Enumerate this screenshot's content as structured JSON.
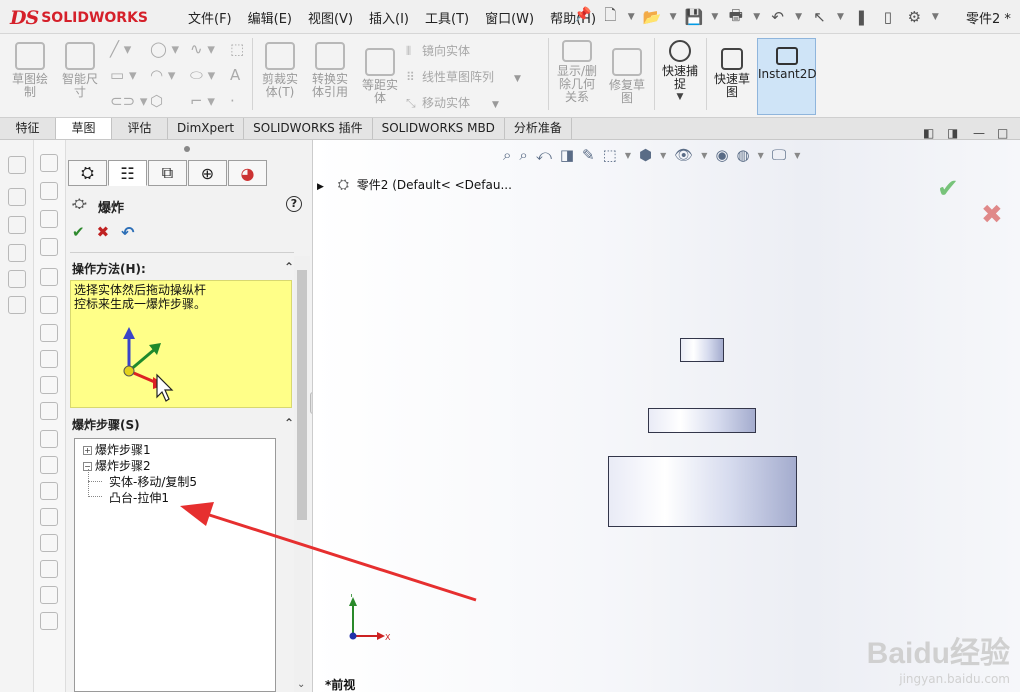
{
  "app": {
    "logo_ds": "DS",
    "logo_name": "SOLIDWORKS",
    "doc_title": "零件2 *"
  },
  "menu": [
    "文件(F)",
    "编辑(E)",
    "视图(V)",
    "插入(I)",
    "工具(T)",
    "窗口(W)",
    "帮助(H)"
  ],
  "ribbon": {
    "sketch": "草图绘\n制",
    "smart_dim": "智能尺\n寸",
    "trim": "剪裁实\n体(T)",
    "convert": "转换实\n体引用",
    "offset": "等距实\n体",
    "mirror": "镜向实体",
    "linear_pattern": "线性草图阵列",
    "move": "移动实体",
    "display_delete": "显示/删\n除几何\n关系",
    "repair": "修复草\n图",
    "quick_snap": "快速捕\n捉",
    "rapid_sketch": "快速草\n图",
    "instant2d": "Instant2D"
  },
  "tabs": [
    "特征",
    "草图",
    "评估",
    "DimXpert",
    "SOLIDWORKS 插件",
    "SOLIDWORKS MBD",
    "分析准备"
  ],
  "pm": {
    "title": "爆炸",
    "method_header": "操作方法(H):",
    "message_line1": "选择实体然后拖动操纵杆",
    "message_line2": "控标来生成一爆炸步骤。",
    "steps_header": "爆炸步骤(S)",
    "tree": {
      "step1": "爆炸步骤1",
      "step2": "爆炸步骤2",
      "child1": "实体-移动/复制5",
      "child2": "凸台-拉伸1"
    }
  },
  "graphics": {
    "tree_path": "零件2  (Default< <Defau...",
    "view_label": "*前视",
    "watermark_big": "Baidu经验",
    "watermark_small": "jingyan.baidu.com"
  },
  "colors": {
    "brand": "#d5202a",
    "annotation_arrow": "#e62f2f",
    "active_button": "#cfe4f7"
  }
}
